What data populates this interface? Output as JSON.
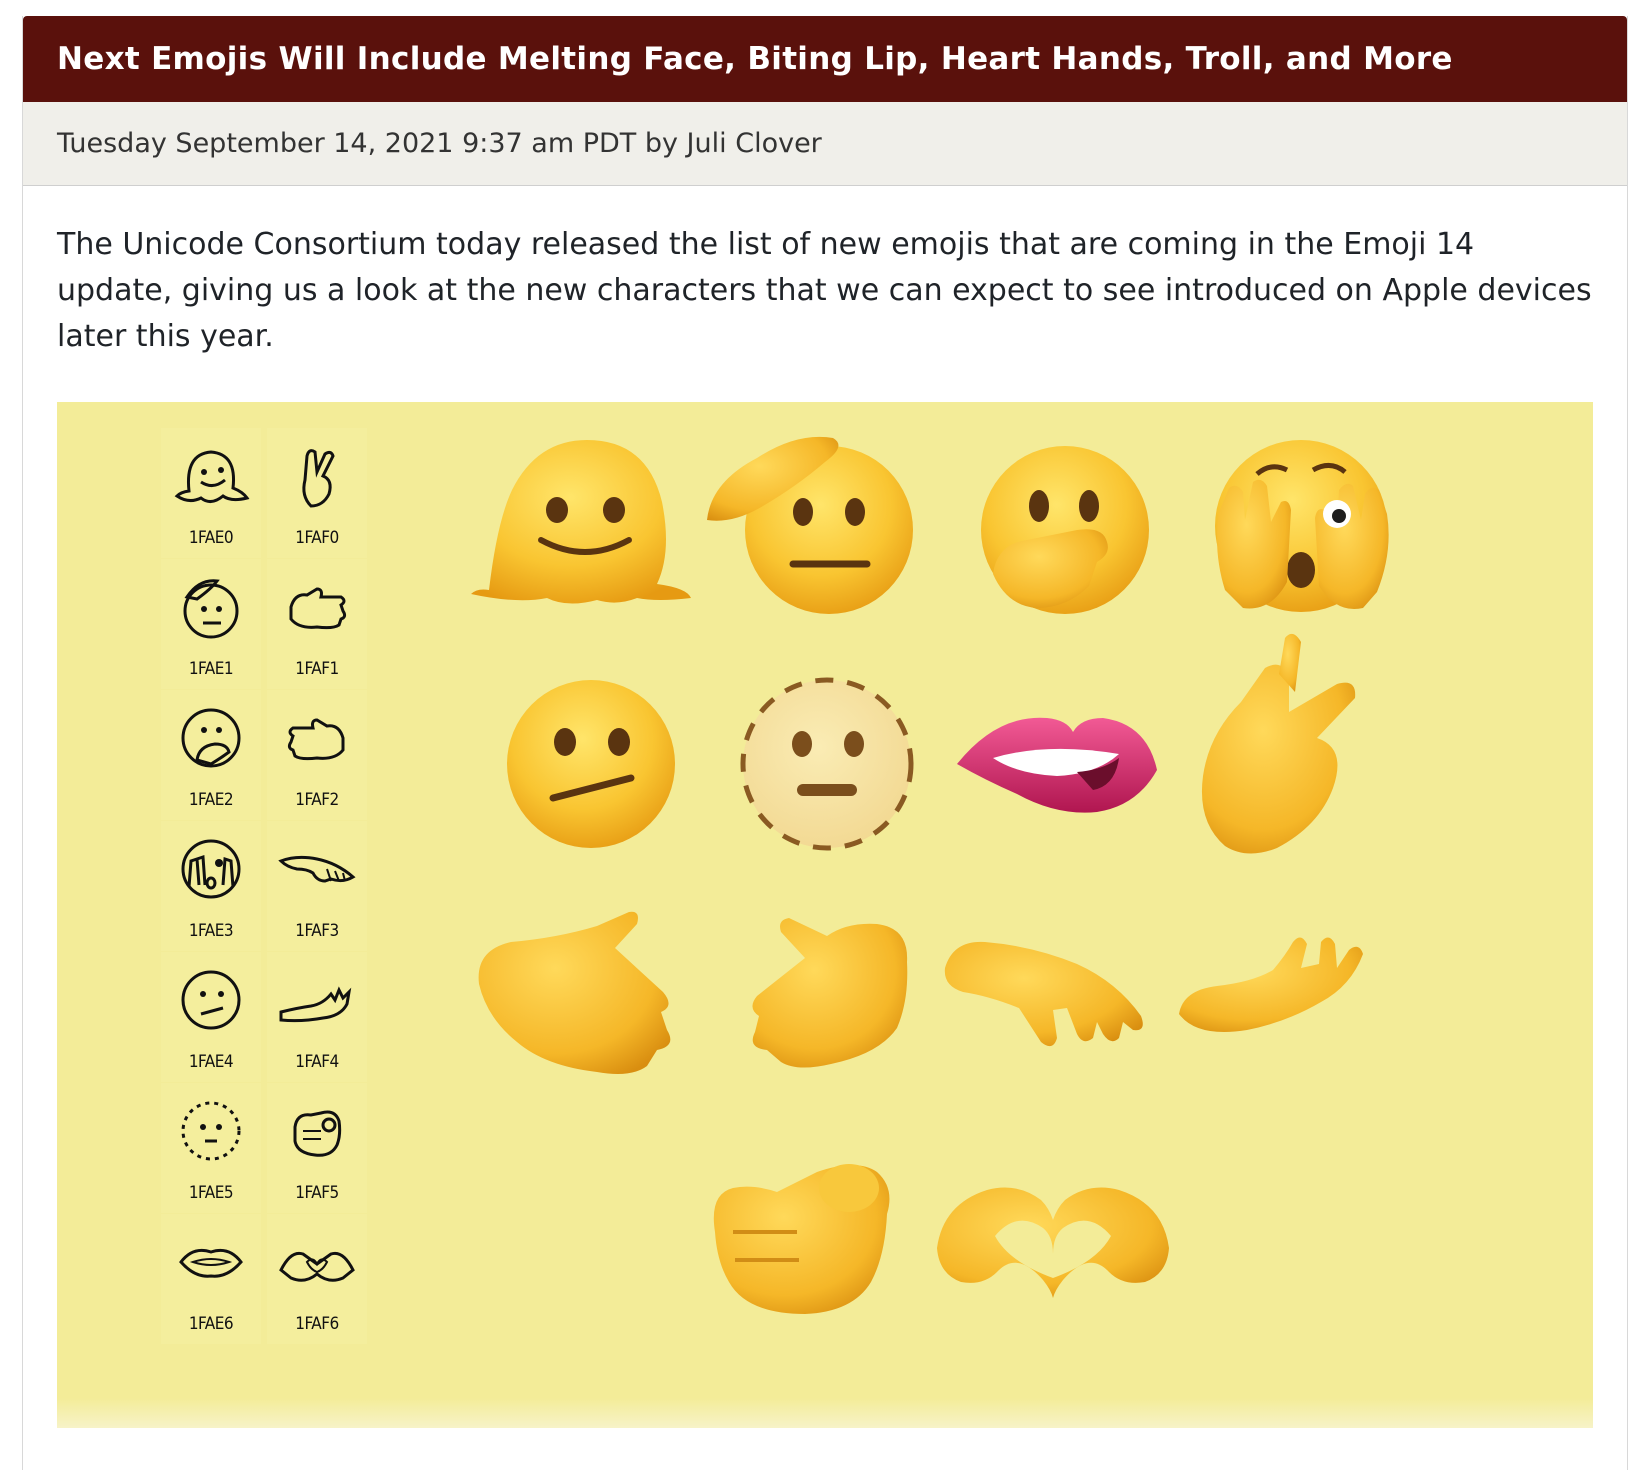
{
  "article": {
    "title": "Next Emojis Will Include Melting Face, Biting Lip, Heart Hands, Troll, and More",
    "byline": "Tuesday September 14, 2021 9:37 am PDT by Juli Clover",
    "paragraph": "The Unicode Consortium today released the list of new emojis that are coming in the Emoji 14 update, giving us a look at the new characters that we can expect to see introduced on Apple devices later this year."
  },
  "figure": {
    "background": "#f3ec98",
    "codes": {
      "col1": [
        "1FAE0",
        "1FAE1",
        "1FAE2",
        "1FAE3",
        "1FAE4",
        "1FAE5",
        "1FAE6"
      ],
      "col2": [
        "1FAF0",
        "1FAF1",
        "1FAF2",
        "1FAF3",
        "1FAF4",
        "1FAF5",
        "1FAF6"
      ]
    },
    "emoji_icons": [
      "melting-face-icon",
      "saluting-face-icon",
      "face-open-eyes-hand-over-mouth-icon",
      "face-peeking-eye-icon",
      "face-diagonal-mouth-icon",
      "dotted-line-face-icon",
      "biting-lip-icon",
      "hand-index-thumb-crossed-icon",
      "rightwards-hand-icon",
      "leftwards-hand-icon",
      "palm-down-hand-icon",
      "palm-up-hand-icon",
      "index-pointing-at-viewer-icon",
      "heart-hands-icon"
    ]
  }
}
